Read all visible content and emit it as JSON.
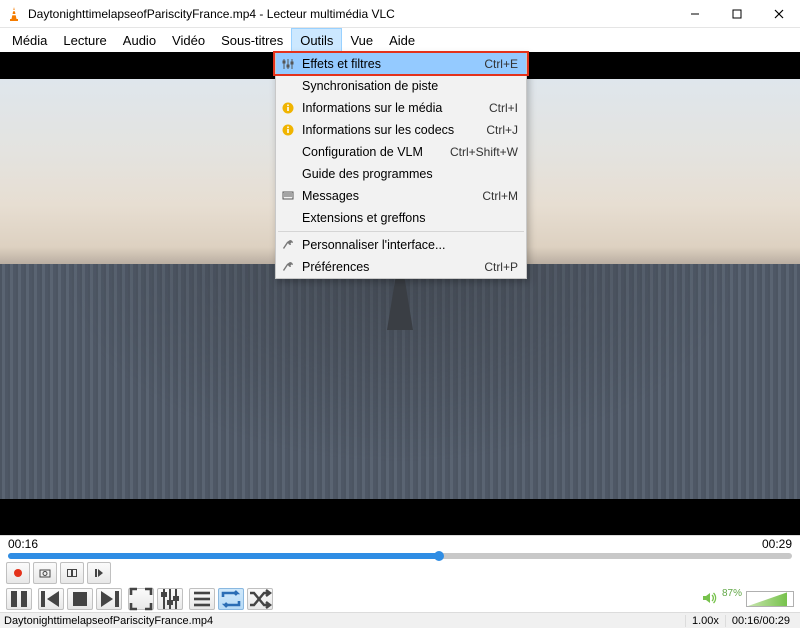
{
  "filename": "DaytonighttimelapseofPariscityFrance.mp4",
  "app_name": "Lecteur multimédia VLC",
  "window_title": "DaytonighttimelapseofPariscityFrance.mp4 - Lecteur multimédia VLC",
  "menubar": {
    "media": {
      "label": "Média"
    },
    "lecture": {
      "label": "Lecture"
    },
    "audio": {
      "label": "Audio"
    },
    "video": {
      "label": "Vidéo"
    },
    "sous": {
      "label": "Sous-titres"
    },
    "outils": {
      "label": "Outils"
    },
    "vue": {
      "label": "Vue"
    },
    "aide": {
      "label": "Aide"
    }
  },
  "dropdown": {
    "effects": {
      "label": "Effets et filtres",
      "shortcut": "Ctrl+E",
      "icon": "sliders-icon"
    },
    "tracksync": {
      "label": "Synchronisation de piste"
    },
    "mediainfo": {
      "label": "Informations sur le média",
      "shortcut": "Ctrl+I",
      "icon": "info-icon"
    },
    "codecinfo": {
      "label": "Informations sur les codecs",
      "shortcut": "Ctrl+J",
      "icon": "info-icon"
    },
    "vlmconf": {
      "label": "Configuration de VLM",
      "shortcut": "Ctrl+Shift+W"
    },
    "guide": {
      "label": "Guide des programmes"
    },
    "messages": {
      "label": "Messages",
      "shortcut": "Ctrl+M",
      "icon": "messages-icon"
    },
    "plugins": {
      "label": "Extensions et greffons"
    },
    "customize": {
      "label": "Personnaliser l'interface...",
      "icon": "wrench-icon"
    },
    "prefs": {
      "label": "Préférences",
      "shortcut": "Ctrl+P",
      "icon": "wrench-icon"
    }
  },
  "time": {
    "elapsed": "00:16",
    "total": "00:29"
  },
  "status": {
    "speed": "1.00x",
    "pos": "00:16/00:29"
  },
  "volume": {
    "percent": "87%"
  }
}
